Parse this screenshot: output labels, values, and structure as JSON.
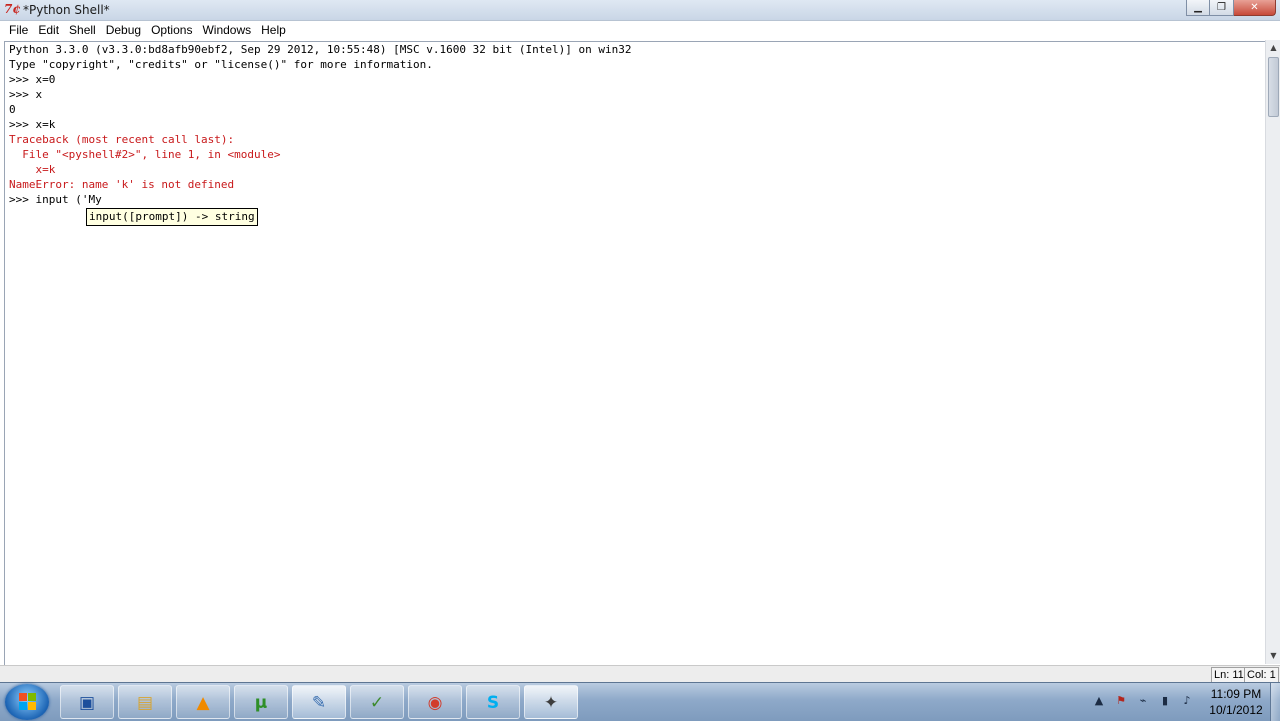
{
  "window": {
    "title": "*Python Shell*",
    "icon_name": "python-idle-icon",
    "controls": {
      "minimize": "▁",
      "maximize": "❐",
      "close": "✕"
    }
  },
  "menu": [
    "File",
    "Edit",
    "Shell",
    "Debug",
    "Options",
    "Windows",
    "Help"
  ],
  "shell": {
    "lines": [
      {
        "text": "Python 3.3.0 (v3.3.0:bd8afb90ebf2, Sep 29 2012, 10:55:48) [MSC v.1600 32 bit (Intel)] on win32",
        "color": "black"
      },
      {
        "text": "Type \"copyright\", \"credits\" or \"license()\" for more information.",
        "color": "black"
      },
      {
        "text": ">>> x=0",
        "color": "black"
      },
      {
        "text": ">>> x",
        "color": "black"
      },
      {
        "text": "0",
        "color": "black"
      },
      {
        "text": ">>> x=k",
        "color": "black"
      },
      {
        "text": "Traceback (most recent call last):",
        "color": "red"
      },
      {
        "text": "  File \"<pyshell#2>\", line 1, in <module>",
        "color": "red"
      },
      {
        "text": "    x=k",
        "color": "red"
      },
      {
        "text": "NameError: name 'k' is not defined",
        "color": "red"
      },
      {
        "text": ">>> input ('My",
        "color": "black"
      }
    ],
    "calltip": "input([prompt]) -> string",
    "error_color": "#c8191b"
  },
  "statusbar": {
    "line": "Ln: 11",
    "col": "Col: 1"
  },
  "taskbar": {
    "buttons": [
      {
        "name": "remote-desktop-icon",
        "glyph": "▣",
        "color": "#1d4f9c"
      },
      {
        "name": "explorer-folder-icon",
        "glyph": "▤",
        "color": "#d7a431"
      },
      {
        "name": "vlc-icon",
        "glyph": "▲",
        "color": "#f08a00"
      },
      {
        "name": "utorrent-icon",
        "glyph": "µ",
        "color": "#2f8f28"
      },
      {
        "name": "python-file-icon",
        "glyph": "✎",
        "color": "#3a6fb0"
      },
      {
        "name": "chart-app-icon",
        "glyph": "✓",
        "color": "#3c8a2c"
      },
      {
        "name": "chrome-icon",
        "glyph": "◉",
        "color": "#d23c2c"
      },
      {
        "name": "skype-icon",
        "glyph": "S",
        "color": "#00aff0"
      },
      {
        "name": "python-idle-icon",
        "glyph": "✦",
        "color": "#3d3d3d"
      }
    ],
    "clock_time": "11:09 PM",
    "clock_date": "10/1/2012"
  }
}
